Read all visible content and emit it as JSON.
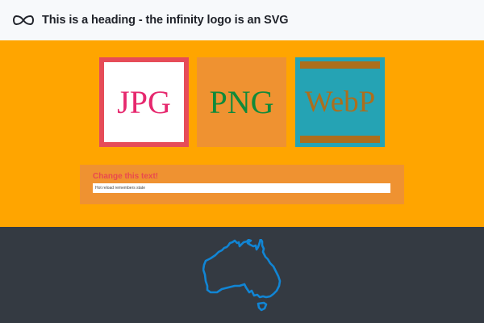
{
  "header": {
    "title": "This is a heading - the infinity logo is an SVG",
    "logo_icon": "infinity-icon"
  },
  "images": [
    {
      "label": "JPG",
      "format": "jpg"
    },
    {
      "label": "PNG",
      "format": "png"
    },
    {
      "label": "WebP",
      "format": "webp"
    }
  ],
  "card": {
    "title": "Change this text!",
    "input_value": "Hot reload remembers state"
  },
  "footer": {
    "map_icon": "australia-map-icon"
  },
  "colors": {
    "header_bg": "#f7f9fb",
    "orange_bg": "#ffa500",
    "dark_bg": "#343a42",
    "jpg_border": "#e64c58",
    "jpg_text": "#e6286e",
    "png_bg": "#ef9231",
    "png_text": "#108a3a",
    "webp_bg": "#25a3b4",
    "webp_text": "#ad6e1c",
    "card_title": "#e9494e",
    "map_stroke": "#1185d4"
  }
}
